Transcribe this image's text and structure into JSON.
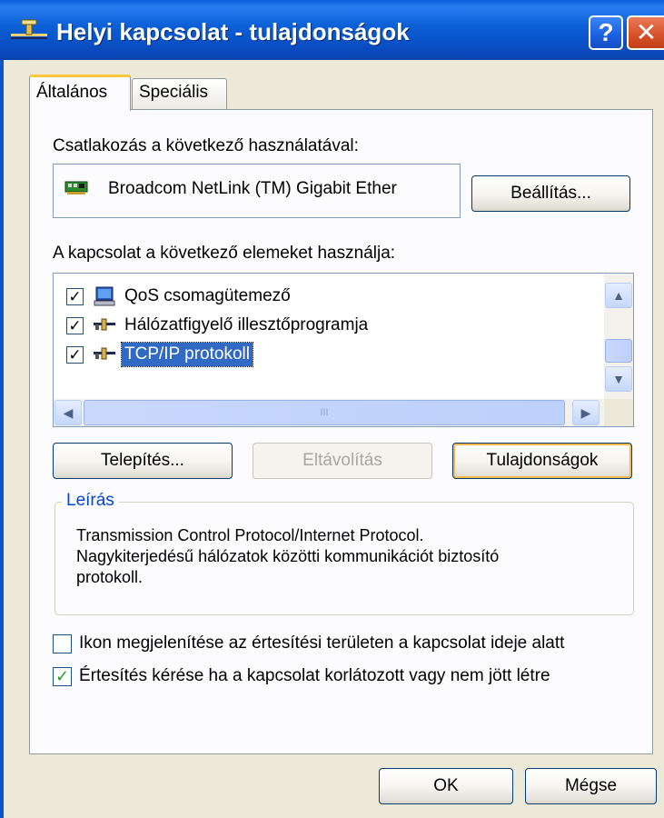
{
  "window": {
    "title": "Helyi kapcsolat - tulajdonságok",
    "help_label": "?",
    "close_label": "✕"
  },
  "tabs": [
    {
      "label": "Általános",
      "active": true
    },
    {
      "label": "Speciális",
      "active": false
    }
  ],
  "connect_using": {
    "label": "Csatlakozás a következő használatával:",
    "adapter_name": "Broadcom NetLink (TM) Gigabit Ether",
    "adapter_icon": "network-card-icon",
    "configure_label": "Beállítás..."
  },
  "components": {
    "label": "A kapcsolat a következő elemeket használja:",
    "items": [
      {
        "label": "QoS csomagütemező",
        "checked": true,
        "icon": "qos-scheduler-icon",
        "selected": false
      },
      {
        "label": "Hálózatfigyelő illesztőprogramja",
        "checked": true,
        "icon": "network-protocol-icon",
        "selected": false
      },
      {
        "label": "TCP/IP protokoll",
        "checked": true,
        "icon": "network-protocol-icon",
        "selected": true
      }
    ],
    "hscroll_thumb_label": "III"
  },
  "buttons": {
    "install": "Telepítés...",
    "uninstall": "Eltávolítás",
    "properties": "Tulajdonságok"
  },
  "description": {
    "legend": "Leírás",
    "line1": "Transmission Control Protocol/Internet Protocol.",
    "line2": "Nagykiterjedésű hálózatok közötti kommunikációt biztosító",
    "line3": "protokoll."
  },
  "options": [
    {
      "label": "Ikon megjelenítése az értesítési területen a kapcsolat ideje alatt",
      "checked": false
    },
    {
      "label": "Értesítés kérése ha a kapcsolat korlátozott vagy nem jött létre",
      "checked": true
    }
  ],
  "footer": {
    "ok": "OK",
    "cancel": "Mégse"
  },
  "colors": {
    "titlebar": "#0a52c8",
    "selection": "#316ac5",
    "group_legend": "#0046d5",
    "focus_accent": "#f5b84d"
  }
}
